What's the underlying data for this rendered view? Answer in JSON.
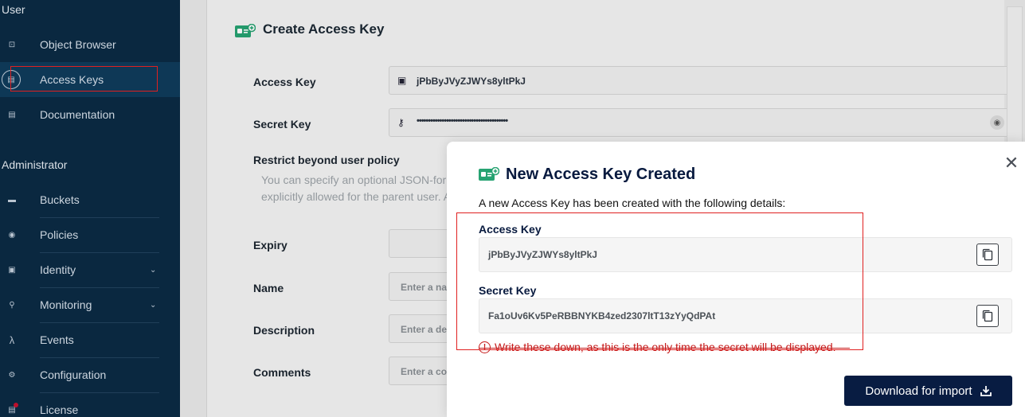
{
  "sidebar": {
    "sections": [
      {
        "title": "User"
      },
      {
        "title": "Administrator"
      }
    ],
    "user_items": [
      {
        "label": "Object Browser",
        "icon": "object-browser-icon"
      },
      {
        "label": "Access Keys",
        "icon": "access-keys-icon"
      },
      {
        "label": "Documentation",
        "icon": "documentation-icon"
      }
    ],
    "admin_items": [
      {
        "label": "Buckets",
        "icon": "bucket-icon"
      },
      {
        "label": "Policies",
        "icon": "policy-icon"
      },
      {
        "label": "Identity",
        "icon": "identity-icon"
      },
      {
        "label": "Monitoring",
        "icon": "monitoring-icon"
      },
      {
        "label": "Events",
        "icon": "lambda-icon"
      },
      {
        "label": "Configuration",
        "icon": "gear-icon"
      },
      {
        "label": "License",
        "icon": "license-icon"
      }
    ]
  },
  "form": {
    "title": "Create Access Key",
    "access_key_label": "Access Key",
    "access_key_value": "jPbByJVyZJWYs8yltPkJ",
    "secret_key_label": "Secret Key",
    "secret_key_value": "••••••••••••••••••••••••••••••••••••••••",
    "restrict_label": "Restrict beyond user policy",
    "restrict_hint_1": "You can specify an optional JSON-forma",
    "restrict_hint_2": "explicitly allowed for the parent user. Ad",
    "expiry_label": "Expiry",
    "name_label": "Name",
    "name_placeholder": "Enter a name",
    "description_label": "Description",
    "description_placeholder": "Enter a descrip",
    "comments_label": "Comments",
    "comments_placeholder": "Enter a comme"
  },
  "modal": {
    "title": "New Access Key Created",
    "description": "A new Access Key has been created with the following details:",
    "access_key_label": "Access Key",
    "access_key_value": "jPbByJVyZJWYs8yltPkJ",
    "secret_key_label": "Secret Key",
    "secret_key_value": "Fa1oUv6Kv5PeRBBNYKB4zed2307ltT13zYyQdPAt",
    "warning": "Write these down, as this is the only time the secret will be displayed.",
    "download_label": "Download for import",
    "close_symbol": "✕"
  },
  "colors": {
    "sidebar_bg": "#0b2b44",
    "accent_dark": "#081c42",
    "warning_red": "#c51b1b",
    "highlight_red": "#e02020",
    "icon_green": "#27a372"
  }
}
